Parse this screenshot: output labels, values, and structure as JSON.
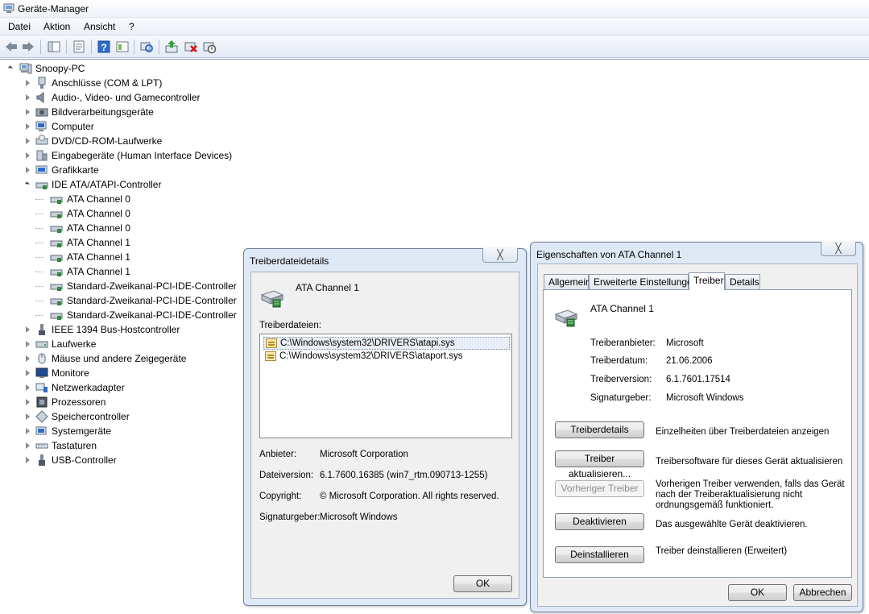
{
  "window": {
    "title": "Geräte-Manager"
  },
  "menu": [
    "Datei",
    "Aktion",
    "Ansicht",
    "?"
  ],
  "toolbar": [
    "back-icon",
    "forward-icon",
    "show-hide-tree-icon",
    "properties-icon",
    "help-icon",
    "view-icon",
    "scan-hardware-icon",
    "update-driver-icon",
    "uninstall-icon",
    "disable-icon"
  ],
  "tree": {
    "root": "Snoopy-PC",
    "categories": [
      {
        "label": "Anschlüsse (COM & LPT)",
        "icon": "port-icon"
      },
      {
        "label": "Audio-, Video- und Gamecontroller",
        "icon": "speaker-icon"
      },
      {
        "label": "Bildverarbeitungsgeräte",
        "icon": "camera-icon"
      },
      {
        "label": "Computer",
        "icon": "computer-icon"
      },
      {
        "label": "DVD/CD-ROM-Laufwerke",
        "icon": "dvd-drive-icon"
      },
      {
        "label": "Eingabegeräte (Human Interface Devices)",
        "icon": "hid-icon"
      },
      {
        "label": "Grafikkarte",
        "icon": "display-adapter-icon"
      },
      {
        "label": "IDE ATA/ATAPI-Controller",
        "icon": "ide-controller-icon"
      },
      {
        "label": "IEEE 1394 Bus-Hostcontroller",
        "icon": "firewire-icon"
      },
      {
        "label": "Laufwerke",
        "icon": "disk-drive-icon"
      },
      {
        "label": "Mäuse und andere Zeigegeräte",
        "icon": "mouse-icon"
      },
      {
        "label": "Monitore",
        "icon": "monitor-icon"
      },
      {
        "label": "Netzwerkadapter",
        "icon": "network-adapter-icon"
      },
      {
        "label": "Prozessoren",
        "icon": "processor-icon"
      },
      {
        "label": "Speichercontroller",
        "icon": "storage-controller-icon"
      },
      {
        "label": "Systemgeräte",
        "icon": "system-device-icon"
      },
      {
        "label": "Tastaturen",
        "icon": "keyboard-icon"
      },
      {
        "label": "USB-Controller",
        "icon": "usb-icon"
      }
    ],
    "ide_children": [
      "ATA Channel 0",
      "ATA Channel 0",
      "ATA Channel 0",
      "ATA Channel 1",
      "ATA Channel 1",
      "ATA Channel 1",
      "Standard-Zweikanal-PCI-IDE-Controller",
      "Standard-Zweikanal-PCI-IDE-Controller",
      "Standard-Zweikanal-PCI-IDE-Controller"
    ]
  },
  "driver_details": {
    "title": "Treiberdateidetails",
    "close": "╳",
    "device": "ATA Channel 1",
    "files_label": "Treiberdateien:",
    "files": [
      "C:\\Windows\\system32\\DRIVERS\\atapi.sys",
      "C:\\Windows\\system32\\DRIVERS\\ataport.sys"
    ],
    "fields": [
      {
        "label": "Anbieter:",
        "value": "Microsoft Corporation"
      },
      {
        "label": "Dateiversion:",
        "value": "6.1.7600.16385 (win7_rtm.090713-1255)"
      },
      {
        "label": "Copyright:",
        "value": "© Microsoft Corporation. All rights reserved."
      },
      {
        "label": "Signaturgeber:",
        "value": "Microsoft Windows"
      }
    ],
    "ok": "OK"
  },
  "properties": {
    "title": "Eigenschaften von ATA Channel 1",
    "close": "╳",
    "tabs": [
      "Allgemein",
      "Erweiterte Einstellungen",
      "Treiber",
      "Details"
    ],
    "active_tab": "Treiber",
    "device": "ATA Channel 1",
    "fields": [
      {
        "label": "Treiberanbieter:",
        "value": "Microsoft"
      },
      {
        "label": "Treiberdatum:",
        "value": "21.06.2006"
      },
      {
        "label": "Treiberversion:",
        "value": "6.1.7601.17514"
      },
      {
        "label": "Signaturgeber:",
        "value": "Microsoft Windows"
      }
    ],
    "actions": [
      {
        "button": "Treiberdetails",
        "desc": "Einzelheiten über Treiberdateien anzeigen",
        "enabled": true
      },
      {
        "button": "Treiber aktualisieren...",
        "desc": "Treibersoftware für dieses Gerät aktualisieren",
        "enabled": true
      },
      {
        "button": "Vorheriger Treiber",
        "desc1": "Vorherigen Treiber verwenden, falls das Gerät",
        "desc2": "nach der Treiberaktualisierung nicht",
        "desc3": "ordnungsgemäß funktioniert.",
        "enabled": false
      },
      {
        "button": "Deaktivieren",
        "desc": "Das ausgewählte Gerät deaktivieren.",
        "enabled": true
      },
      {
        "button": "Deinstallieren",
        "desc": "Treiber deinstallieren (Erweitert)",
        "enabled": true
      }
    ],
    "ok": "OK",
    "cancel": "Abbrechen"
  }
}
